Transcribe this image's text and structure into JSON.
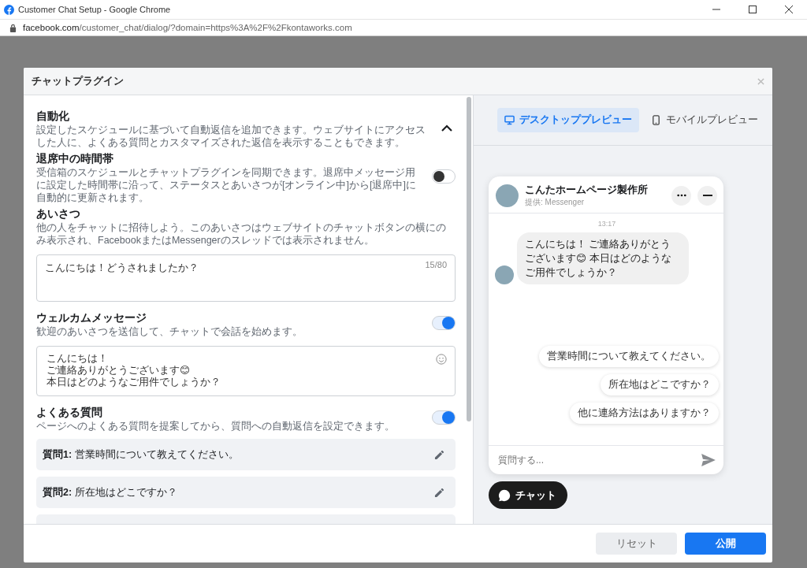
{
  "window": {
    "title": "Customer Chat Setup - Google Chrome",
    "url_host": "facebook.com",
    "url_path": "/customer_chat/dialog/?domain=https%3A%2F%2Fkontaworks.com"
  },
  "dialog": {
    "title": "チャットプラグイン"
  },
  "automation": {
    "title": "自動化",
    "description": "設定したスケジュールに基づいて自動返信を追加できます。ウェブサイトにアクセスした人に、よくある質問とカスタマイズされた返信を表示することもできます。",
    "expanded": true
  },
  "sections": [
    {
      "kind": "toggle",
      "title": "退席中の時間帯",
      "description": "受信箱のスケジュールとチャットプラグインを同期できます。退席中メッセージ用に設定した時間帯に沿って、ステータスとあいさつが[オンライン中]から[退席中]に自動的に更新されます。",
      "on": false
    },
    {
      "kind": "greeting",
      "title": "あいさつ",
      "description": "他の人をチャットに招待しよう。このあいさつはウェブサイトのチャットボタンの横にのみ表示され、FacebookまたはMessengerのスレッドでは表示されません。",
      "value": "こんにちは！どうされましたか？",
      "counter": "15/80"
    },
    {
      "kind": "welcome",
      "title": "ウェルカムメッセージ",
      "description": "歓迎のあいさつを送信して、チャットで会話を始めます。",
      "on": true,
      "lines": [
        "こんにちは！",
        "ご連絡ありがとうございます😊",
        "本日はどのようなご用件でしょうか？"
      ]
    },
    {
      "kind": "faq",
      "title": "よくある質問",
      "description": "ページへのよくある質問を提案してから、質問への自動返信を設定できます。",
      "on": true,
      "questions": [
        "**質問1:** 営業時間について教えてください。",
        "**質問2:** 所在地はどこですか？"
      ]
    }
  ],
  "preview_tabs": [
    {
      "label": "デスクトッププレビュー",
      "kind": "desktop",
      "selected": true
    },
    {
      "label": "モバイルプレビュー",
      "kind": "mobile",
      "selected": false
    }
  ],
  "chat": {
    "name": "こんたホームページ製作所",
    "subtitle": "提供: Messenger",
    "time": "13:17",
    "message": "こんにちは！ ご連絡ありがとうございます😊 本日はどのようなご用件でしょうか？",
    "quick_replies": [
      "営業時間について教えてください。",
      "所在地はどこですか？",
      "他に連絡方法はありますか？"
    ],
    "placeholder": "質問する...",
    "button": "チャット"
  },
  "footer": {
    "buttons": [
      {
        "label": "リセット",
        "kind": "secondary"
      },
      {
        "label": "公開",
        "kind": "primary"
      }
    ]
  }
}
